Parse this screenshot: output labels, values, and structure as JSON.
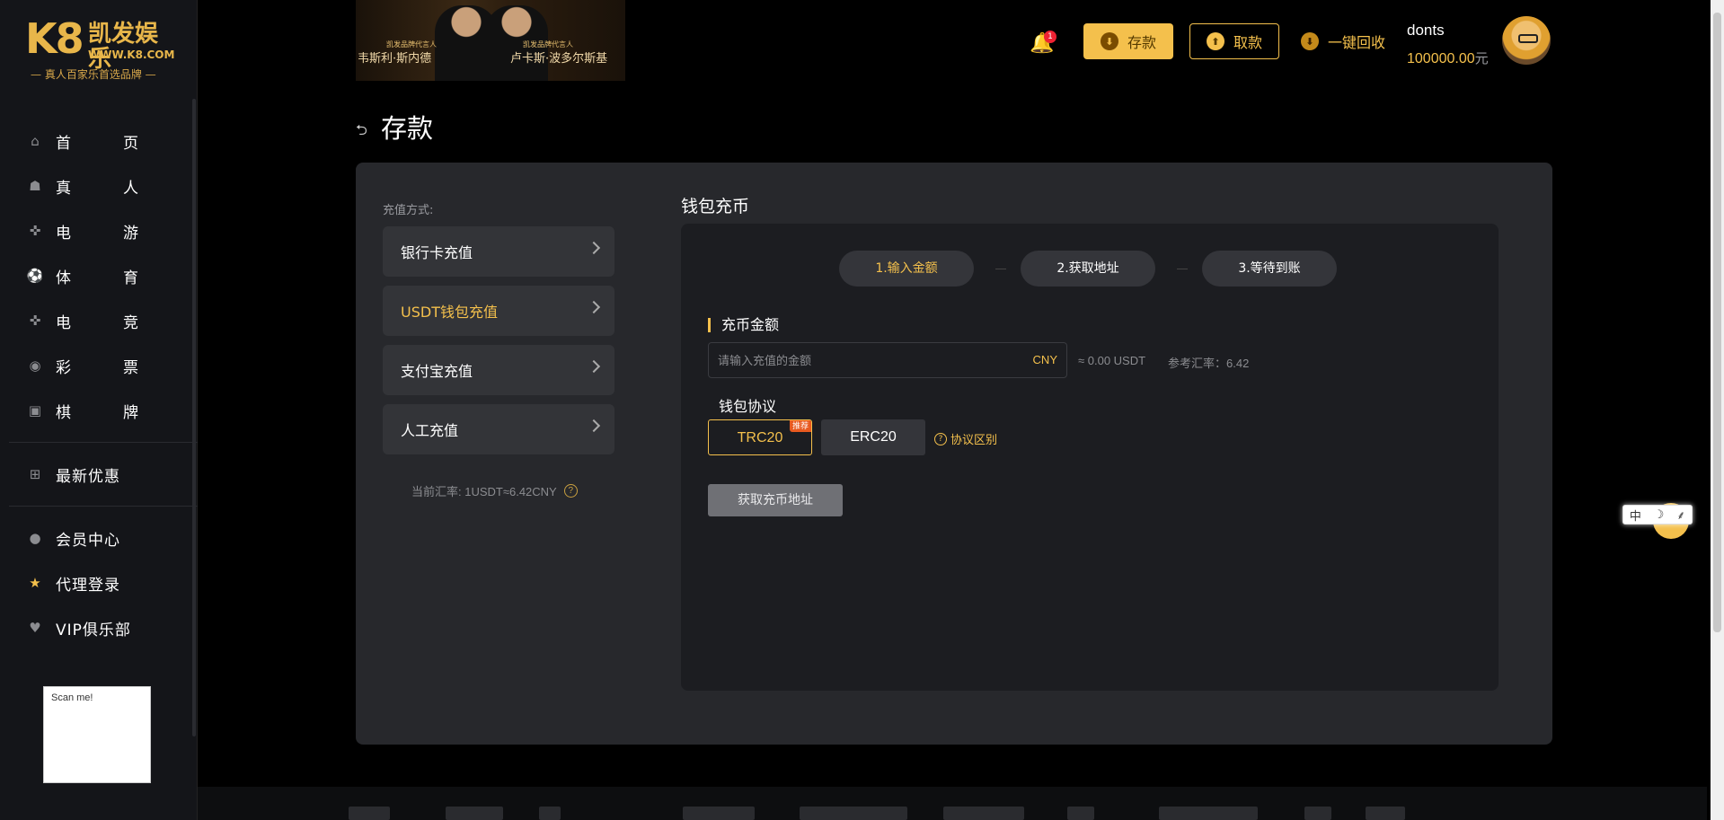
{
  "logo": {
    "mark": "K8",
    "brand": "凯发娱乐",
    "url": "WWW.K8.COM",
    "slogan": "— 真人百家乐首选品牌 —"
  },
  "banner": {
    "left_small": "凯发品牌代言人",
    "left_name": "韦斯利·斯内德",
    "right_small": "凯发品牌代言人",
    "right_name": "卢卡斯·波多尔斯基"
  },
  "sidebar": {
    "items": [
      {
        "label": "首页",
        "c1": "首",
        "c2": "页",
        "icon": "home-icon"
      },
      {
        "label": "真人",
        "c1": "真",
        "c2": "人",
        "icon": "live-dealer-icon"
      },
      {
        "label": "电游",
        "c1": "电",
        "c2": "游",
        "icon": "gamepad-icon"
      },
      {
        "label": "体育",
        "c1": "体",
        "c2": "育",
        "icon": "soccer-icon"
      },
      {
        "label": "电竞",
        "c1": "电",
        "c2": "竞",
        "icon": "esports-icon"
      },
      {
        "label": "彩票",
        "c1": "彩",
        "c2": "票",
        "icon": "lottery-icon"
      },
      {
        "label": "棋牌",
        "c1": "棋",
        "c2": "牌",
        "icon": "cards-icon"
      }
    ],
    "promo": "最新优惠",
    "member": "会员中心",
    "agent": "代理登录",
    "vip": "VIP俱乐部",
    "qr_alt": "Scan me!"
  },
  "header": {
    "notification_count": "1",
    "deposit": "存款",
    "withdraw": "取款",
    "recycle": "一键回收",
    "username": "donts",
    "balance": "100000.00",
    "balance_unit": "元"
  },
  "page": {
    "back": "⮌",
    "title": "存款"
  },
  "methods": {
    "label": "充值方式:",
    "items": [
      "银行卡充值",
      "USDT钱包充值",
      "支付宝充值",
      "人工充值"
    ],
    "active_index": 1,
    "rate_note": "当前汇率: 1USDT≈6.42CNY"
  },
  "wallet": {
    "title": "钱包充币",
    "steps": [
      "1.输入金额",
      "2.获取地址",
      "3.等待到账"
    ],
    "amount_label": "充币金额",
    "amount_placeholder": "请输入充值的金额",
    "amount_currency": "CNY",
    "converted": "≈ 0.00 USDT",
    "reference_rate": "参考汇率：6.42",
    "protocol_label": "钱包协议",
    "protocols": [
      "TRC20",
      "ERC20"
    ],
    "recommend_tag": "推荐",
    "protocol_diff": "协议区别",
    "get_address": "获取充币地址"
  },
  "ime": {
    "c1": "中",
    "c2": "☽",
    "c3": "⸙"
  },
  "colors": {
    "accent": "#f4c04c",
    "panel": "#27282c",
    "sidebar": "#141519"
  }
}
